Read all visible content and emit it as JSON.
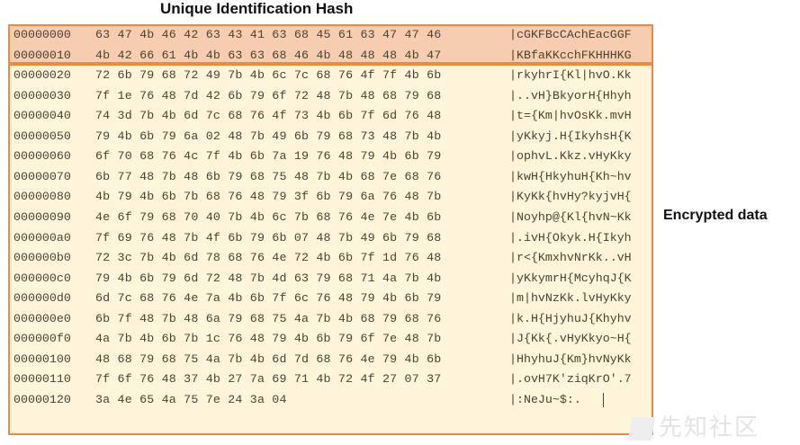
{
  "labels": {
    "hash": "Unique Identification Hash",
    "encrypted": "Encrypted data"
  },
  "watermark": "先知社区",
  "rows": [
    {
      "offset": "00000000",
      "hex": "63 47 4b 46 42 63 43 41 63 68 45 61 63 47 47 46",
      "ascii": "|cGKFBcCAchEacGGF"
    },
    {
      "offset": "00000010",
      "hex": "4b 42 66 61 4b 4b 63 63 68 46 4b 48 48 48 4b 47",
      "ascii": "|KBfaKKcchFKHHHKG"
    },
    {
      "offset": "00000020",
      "hex": "72 6b 79 68 72 49 7b 4b 6c 7c 68 76 4f 7f 4b 6b",
      "ascii": "|rkyhrI{Kl|hvO.Kk"
    },
    {
      "offset": "00000030",
      "hex": "7f 1e 76 48 7d 42 6b 79 6f 72 48 7b 48 68 79 68",
      "ascii": "|..vH}BkyorH{Hhyh"
    },
    {
      "offset": "00000040",
      "hex": "74 3d 7b 4b 6d 7c 68 76 4f 73 4b 6b 7f 6d 76 48",
      "ascii": "|t={Km|hvOsKk.mvH"
    },
    {
      "offset": "00000050",
      "hex": "79 4b 6b 79 6a 02 48 7b 49 6b 79 68 73 48 7b 4b",
      "ascii": "|yKkyj.H{IkyhsH{K"
    },
    {
      "offset": "00000060",
      "hex": "6f 70 68 76 4c 7f 4b 6b 7a 19 76 48 79 4b 6b 79",
      "ascii": "|ophvL.Kkz.vHyKky"
    },
    {
      "offset": "00000070",
      "hex": "6b 77 48 7b 48 6b 79 68 75 48 7b 4b 68 7e 68 76",
      "ascii": "|kwH{HkyhuH{Kh~hv"
    },
    {
      "offset": "00000080",
      "hex": "4b 79 4b 6b 7b 68 76 48 79 3f 6b 79 6a 76 48 7b",
      "ascii": "|KyKk{hvHy?kyjvH{"
    },
    {
      "offset": "00000090",
      "hex": "4e 6f 79 68 70 40 7b 4b 6c 7b 68 76 4e 7e 4b 6b",
      "ascii": "|Noyhp@{Kl{hvN~Kk"
    },
    {
      "offset": "000000a0",
      "hex": "7f 69 76 48 7b 4f 6b 79 6b 07 48 7b 49 6b 79 68",
      "ascii": "|.ivH{Okyk.H{Ikyh"
    },
    {
      "offset": "000000b0",
      "hex": "72 3c 7b 4b 6d 78 68 76 4e 72 4b 6b 7f 1d 76 48",
      "ascii": "|r<{KmxhvNrKk..vH"
    },
    {
      "offset": "000000c0",
      "hex": "79 4b 6b 79 6d 72 48 7b 4d 63 79 68 71 4a 7b 4b",
      "ascii": "|yKkymrH{McyhqJ{K"
    },
    {
      "offset": "000000d0",
      "hex": "6d 7c 68 76 4e 7a 4b 6b 7f 6c 76 48 79 4b 6b 79",
      "ascii": "|m|hvNzKk.lvHyKky"
    },
    {
      "offset": "000000e0",
      "hex": "6b 7f 48 7b 48 6a 79 68 75 4a 7b 4b 68 79 68 76",
      "ascii": "|k.H{HjyhuJ{Khyhv"
    },
    {
      "offset": "000000f0",
      "hex": "4a 7b 4b 6b 7b 1c 76 48 79 4b 6b 79 6f 7e 48 7b",
      "ascii": "|J{Kk{.vHyKkyo~H{"
    },
    {
      "offset": "00000100",
      "hex": "48 68 79 68 75 4a 7b 4b 6d 7d 68 76 4e 79 4b 6b",
      "ascii": "|HhyhuJ{Km}hvNyKk"
    },
    {
      "offset": "00000110",
      "hex": "7f 6f 76 48 37 4b 27 7a 69 71 4b 72 4f 27 07 37",
      "ascii": "|.ovH7K'ziqKrO'.7"
    },
    {
      "offset": "00000120",
      "hex": "3a 4e 65 4a 75 7e 24 3a 04",
      "ascii": "|:NeJu~$:."
    }
  ]
}
